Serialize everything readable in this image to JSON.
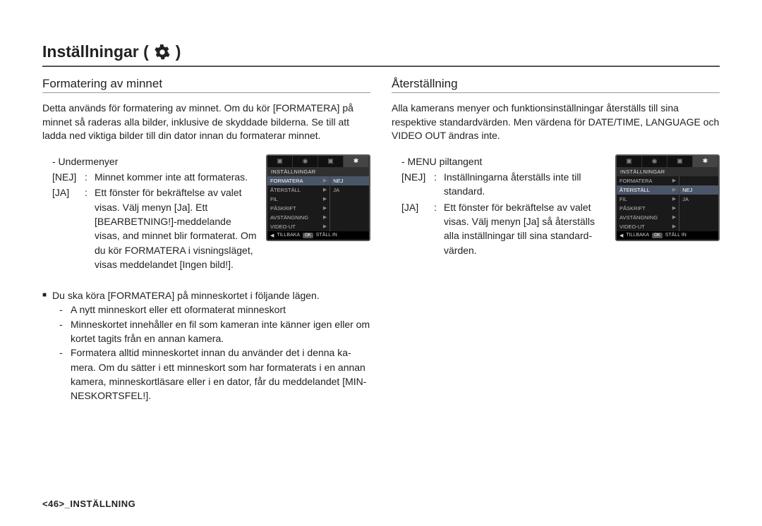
{
  "page_title_prefix": "Inställningar (",
  "page_title_suffix": ")",
  "left": {
    "heading": "Formatering av minnet",
    "intro": "Detta används för formatering av minnet. Om du kör [FORMATERA] på minnet så raderas alla bilder, inklusive de skyddade bilderna. Se till att ladda ned viktiga bilder till din dator innan du formaterar minnet.",
    "submenu_label": "- Undermenyer",
    "items": {
      "nej_k": "[NEJ]",
      "nej_c": ":",
      "nej_v": "Minnet kommer inte att formateras.",
      "ja_k": "[JA]",
      "ja_c": ":",
      "ja_v": "Ett fönster för bekräftelse av valet visas. Välj menyn [Ja]. Ett [BEARBETNING!]-meddelande visas, and minnet blir formaterat. Om du kör FORMATERA i visningsläget, visas meddelandet [Ingen bild!]."
    },
    "note_lead": "Du ska köra [FORMATERA] på minneskortet i följande lägen.",
    "note_items": {
      "a": "A nytt minneskort eller ett oformaterat minneskort",
      "b": "Minneskortet innehåller en fil som kameran inte känner igen eller om kortet tagits från en annan kamera.",
      "c": "Formatera alltid minneskortet innan du använder det i denna ka-mera. Om du sätter i ett minneskort som har formaterats i en annan kamera, minneskortläsare eller i en dator, får du meddelandet [MIN-NESKORTSFEL!]."
    }
  },
  "right": {
    "heading": "Återställning",
    "intro": "Alla kamerans menyer och funktionsinställningar återställs till sina respektive standardvärden. Men värdena för DATE/TIME, LANGUAGE och VIDEO OUT ändras inte.",
    "submenu_label": "- MENU piltangent",
    "items": {
      "nej_k": "[NEJ]",
      "nej_c": ":",
      "nej_v": "Inställningarna återställs inte till standard.",
      "ja_k": "[JA]",
      "ja_c": ":",
      "ja_v": "Ett fönster för bekräftelse av valet visas. Välj menyn [Ja] så återställs alla inställningar till sina standard-värden."
    }
  },
  "lcd": {
    "header": "INSTÄLLNINGAR",
    "left_menu": {
      "formatera": "FORMATERA",
      "aterstall": "ÅTERSTÄLL",
      "fil": "FIL",
      "paskrift": "PÅSKRIFT",
      "avstangning": "AVSTÄNGNING",
      "videout": "VIDEO-UT",
      "nej": "NEJ",
      "ja": "JA"
    },
    "bar_back": "TILLBAKA",
    "bar_ok": "OK",
    "bar_set": "STÄLL IN"
  },
  "footer_page": "<46>",
  "footer_label": "_INSTÄLLNING"
}
